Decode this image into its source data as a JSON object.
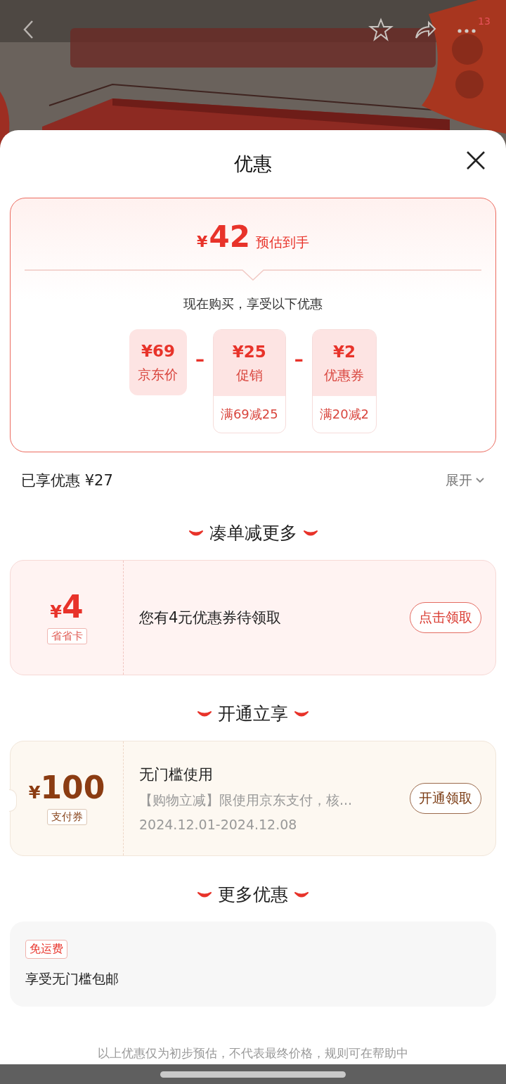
{
  "nav": {
    "badge": "13"
  },
  "sheet": {
    "title": "优惠"
  },
  "estimate": {
    "currency": "¥",
    "amount": "42",
    "label": "预估到手",
    "subtitle": "现在购买，享受以下优惠",
    "items": [
      {
        "amount": "¥69",
        "label": "京东价"
      },
      {
        "operator": "–",
        "amount": "¥25",
        "label": "促销",
        "condition": "满69减25"
      },
      {
        "operator": "–",
        "amount": "¥2",
        "label": "优惠券",
        "condition": "满20减2"
      }
    ]
  },
  "savings": {
    "label": "已享优惠 ¥27",
    "toggle": "展开"
  },
  "sections": [
    {
      "title": "凑单减更多",
      "card": {
        "kind": "voucher",
        "currency": "¥",
        "amount": "4",
        "tag": "省省卡",
        "title": "您有4元优惠券待领取",
        "button": "点击领取"
      }
    },
    {
      "title": "开通立享",
      "card": {
        "kind": "payment",
        "currency": "¥",
        "amount": "100",
        "tag": "支付券",
        "title": "无门槛使用",
        "description": "【购物立减】限使用京东支付，核...",
        "dates": "2024.12.01-2024.12.08",
        "button": "开通领取"
      }
    },
    {
      "title": "更多优惠",
      "card": {
        "kind": "info",
        "tag": "免运费",
        "text": "享受无门槛包邮"
      }
    }
  ],
  "footer_note": "以上优惠仅为初步预估，不代表最终价格，规则可在帮助中"
}
